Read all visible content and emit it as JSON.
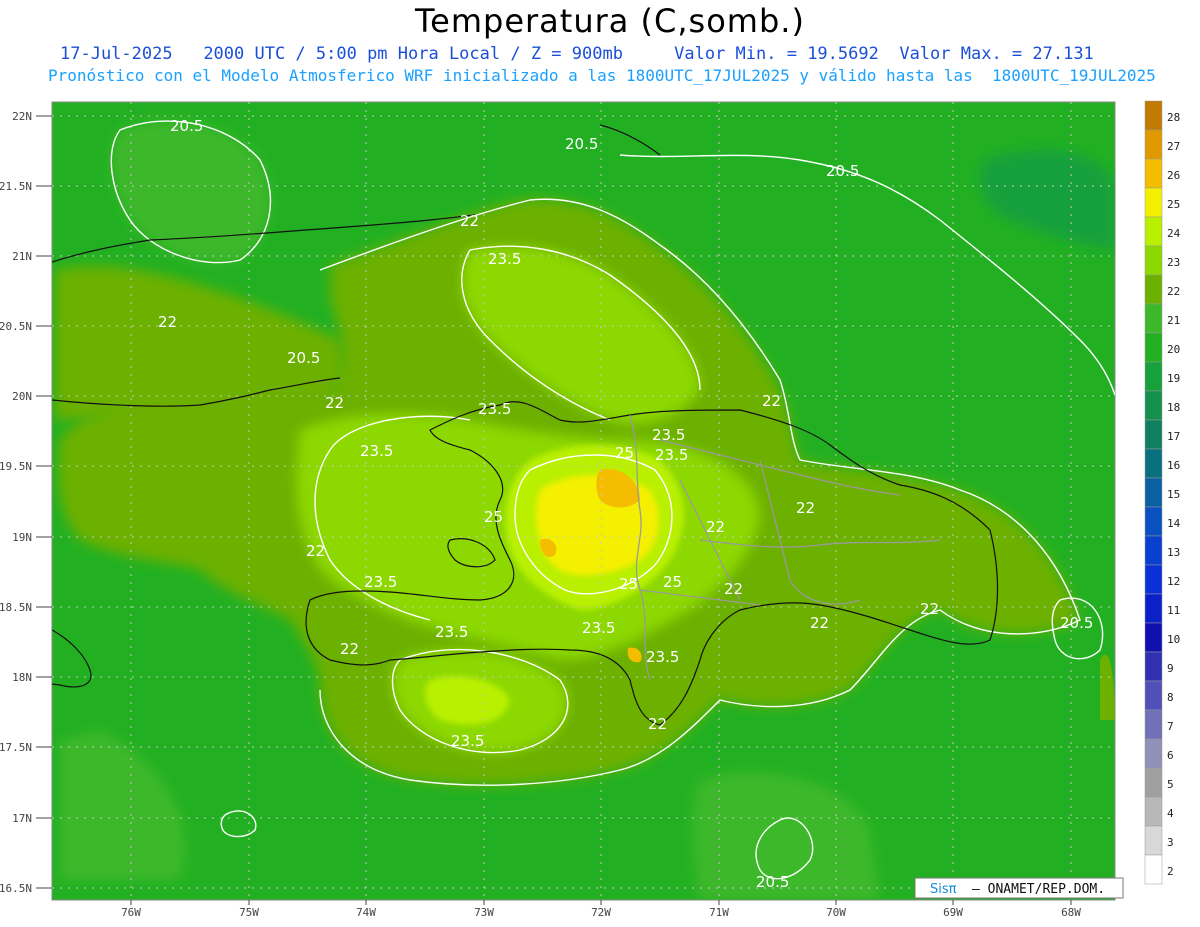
{
  "header": {
    "title": "Temperatura (C,somb.)",
    "date": "17-Jul-2025",
    "valid_time": "2000 UTC / 5:00 pm Hora Local / Z = 900mb",
    "min": "Valor Min. = 19.5692",
    "max": "Valor Max. = 27.131",
    "subtitle": "Pronóstico con el Modelo Atmosferico WRF inicializado a las 1800UTC_17JUL2025 y válido hasta las  1800UTC_19JUL2025"
  },
  "axes": {
    "lat_labels": [
      "22N",
      "21.5N",
      "21N",
      "20.5N",
      "20N",
      "19.5N",
      "19N",
      "18.5N",
      "18N",
      "17.5N",
      "17N",
      "16.5N"
    ],
    "lon_labels": [
      "76W",
      "75W",
      "74W",
      "73W",
      "72W",
      "71W",
      "70W",
      "69W",
      "68W"
    ]
  },
  "colorbar": {
    "labels": [
      "28",
      "27",
      "26",
      "25",
      "24",
      "23",
      "22",
      "21",
      "20",
      "19",
      "18",
      "17",
      "16",
      "15",
      "14",
      "13",
      "12",
      "11",
      "10",
      "9",
      "8",
      "7",
      "6",
      "5",
      "4",
      "3",
      "2"
    ],
    "colors": [
      "#c27a00",
      "#e09a00",
      "#f5bd00",
      "#f5f000",
      "#b8f000",
      "#8cd800",
      "#6cb000",
      "#3cb82a",
      "#22b022",
      "#18a03c",
      "#12904c",
      "#0e8060",
      "#0a7080",
      "#0a60a0",
      "#0a50c0",
      "#0a40d0",
      "#0a30d8",
      "#0a20c8",
      "#1010b0",
      "#3030b0",
      "#5050b8",
      "#7070b8",
      "#9090b8",
      "#a0a0a0",
      "#b8b8b8",
      "#d8d8d8",
      "#ffffff"
    ]
  },
  "contours": {
    "labels": [
      "20.5",
      "20.5",
      "20.5",
      "20.5",
      "20.5",
      "20.5",
      "22",
      "22",
      "22",
      "22",
      "22",
      "22",
      "22",
      "22",
      "22",
      "22",
      "22",
      "22",
      "23.5",
      "23.5",
      "23.5",
      "23.5",
      "23.5",
      "23.5",
      "23.5",
      "23.5",
      "23.5",
      "23.5",
      "25",
      "25",
      "25",
      "25"
    ]
  },
  "credit": {
    "symbol": "Sisπ",
    "text": "– ONAMET/REP.DOM."
  }
}
